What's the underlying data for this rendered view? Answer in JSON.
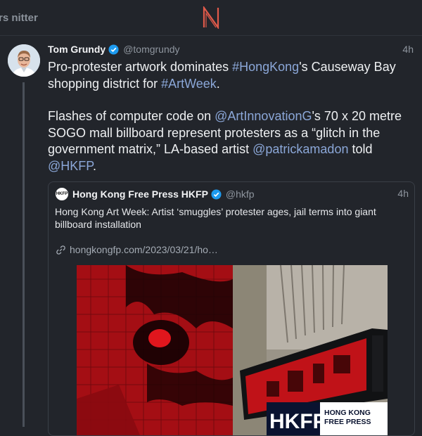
{
  "topbar": {
    "left_label": "rs nitter",
    "logo_icon": "nitter-n-logo",
    "accent": "#e05a4a"
  },
  "tweet": {
    "author_name": "Tom Grundy",
    "author_handle": "@tomgrundy",
    "time": "4h",
    "para1_a": "Pro-protester artwork dominates ",
    "hashtag1": "#HongKong",
    "para1_b": "'s Causeway Bay shopping district for ",
    "hashtag2": "#ArtWeek",
    "para1_c": ".",
    "para2_a": "Flashes of computer code on ",
    "mention1": "@ArtInnovationG",
    "para2_b": "'s 70 x 20 metre SOGO mall billboard represent protesters as a “glitch in the government matrix,” LA-based artist ",
    "mention2": "@patrickamadon",
    "para2_c": " told ",
    "mention3": "@HKFP",
    "para2_d": "."
  },
  "quote": {
    "avatar_text": "HKFP",
    "author_name": "Hong Kong Free Press HKFP",
    "author_handle": "@hkfp",
    "time": "4h",
    "text": "Hong Kong Art Week: Artist ‘smuggles’ protester ages, jail terms into giant billboard installation",
    "link": "hongkongfp.com/2023/03/21/ho…",
    "watermark_big": "HKFP",
    "watermark_line1": "HONG KONG",
    "watermark_line2": "FREE PRESS"
  },
  "colors": {
    "link": "#8ba7d8",
    "verified": "#1d9bf0",
    "billboard_red": "#d8141a"
  }
}
